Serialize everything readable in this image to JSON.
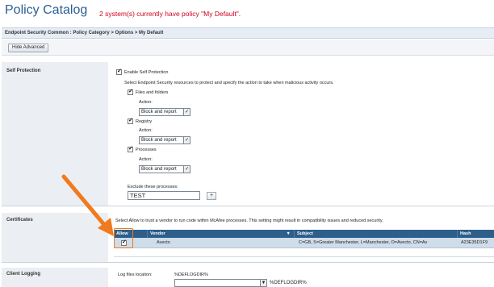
{
  "header": {
    "title": "Policy Catalog",
    "subtitle": "2 system(s) currently have policy \"My Default\"."
  },
  "breadcrumb": "Endpoint Security Common : Policy Category > Options > My Default",
  "toolbar": {
    "hide_advanced_label": "Hide Advanced"
  },
  "self_protection": {
    "label": "Self Protection",
    "enable_label": "Enable Self Protection",
    "description": "Select Endpoint Security resources to protect and specify the action to take when malicious activity occurs.",
    "action_label": "Action:",
    "items": [
      {
        "label": "Files and folders",
        "action": "Block and report"
      },
      {
        "label": "Registry",
        "action": "Block and report"
      },
      {
        "label": "Processes",
        "action": "Block and report"
      }
    ],
    "exclude_label": "Exclude these processes:",
    "exclude_value": "TEST",
    "add_label": "+"
  },
  "certificates": {
    "label": "Certificates",
    "description": "Select Allow to trust a vendor to run code within McAfee processes. This setting might result in compatibility issues and reduced security.",
    "columns": {
      "allow": "Allow",
      "vendor": "Vendor",
      "subject": "Subject",
      "hash": "Hash"
    },
    "sort_icon": "▼",
    "rows": [
      {
        "allow": true,
        "vendor": "Avecto",
        "subject": "C=GB, S=Greater Manchester, L=Manchester, O=Avecto, CN=Av",
        "hash": "A23E35D1F9"
      }
    ]
  },
  "client_logging": {
    "label": "Client Logging",
    "location_label": "Log files location:",
    "location_value": "%DEFLOGDIR%",
    "location_input": "%DEFLOGDIR%"
  },
  "annotation": {
    "arrow_color": "#f07a1d"
  }
}
